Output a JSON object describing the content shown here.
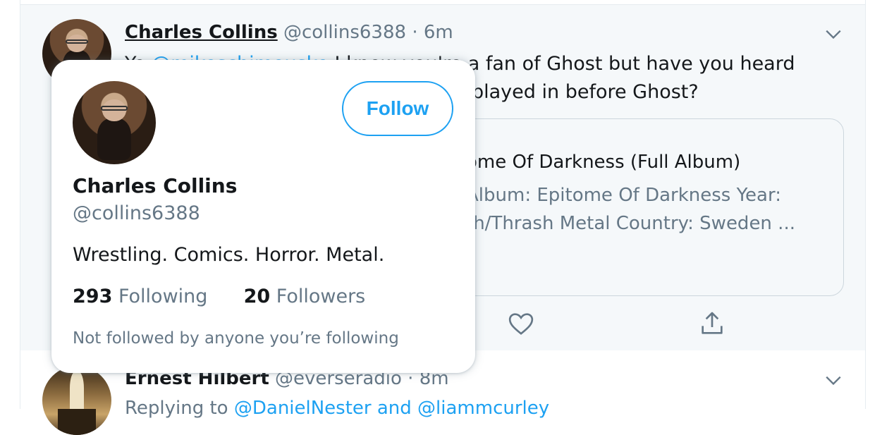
{
  "tweet1": {
    "author_name": "Charles Collins",
    "handle": "@collins6388",
    "separator": "·",
    "time": "6m",
    "text_line1_start": "Yo",
    "text_line1_mention": "@mikeschimouske",
    "text_line1_end": "I know you're a fan of Ghost but have you heard",
    "text_line2_end": "played in before Ghost?",
    "card": {
      "title": "ome Of Darkness (Full Album)",
      "desc_line1": "Album: Epitome Of Darkness Year:",
      "desc_line2": "th/Thrash Metal Country: Sweden ..."
    }
  },
  "hovercard": {
    "follow_label": "Follow",
    "name": "Charles Collins",
    "handle": "@collins6388",
    "bio": "Wrestling. Comics. Horror. Metal.",
    "following_count": "293",
    "following_label": "Following",
    "followers_count": "20",
    "followers_label": "Followers",
    "note": "Not followed by anyone you’re following"
  },
  "tweet2": {
    "author_name": "Ernest Hilbert",
    "handle": "@everseradio",
    "separator": "·",
    "time": "8m",
    "reply_prefix": "Replying to",
    "reply_to": "@DanielNester and @liammcurley"
  },
  "icons": {
    "caret": "chevron-down-icon",
    "like": "heart-icon",
    "share": "share-icon"
  },
  "colors": {
    "accent": "#1da1f2",
    "secondary_text": "#657786",
    "hover_bg": "#f5f8fa"
  }
}
